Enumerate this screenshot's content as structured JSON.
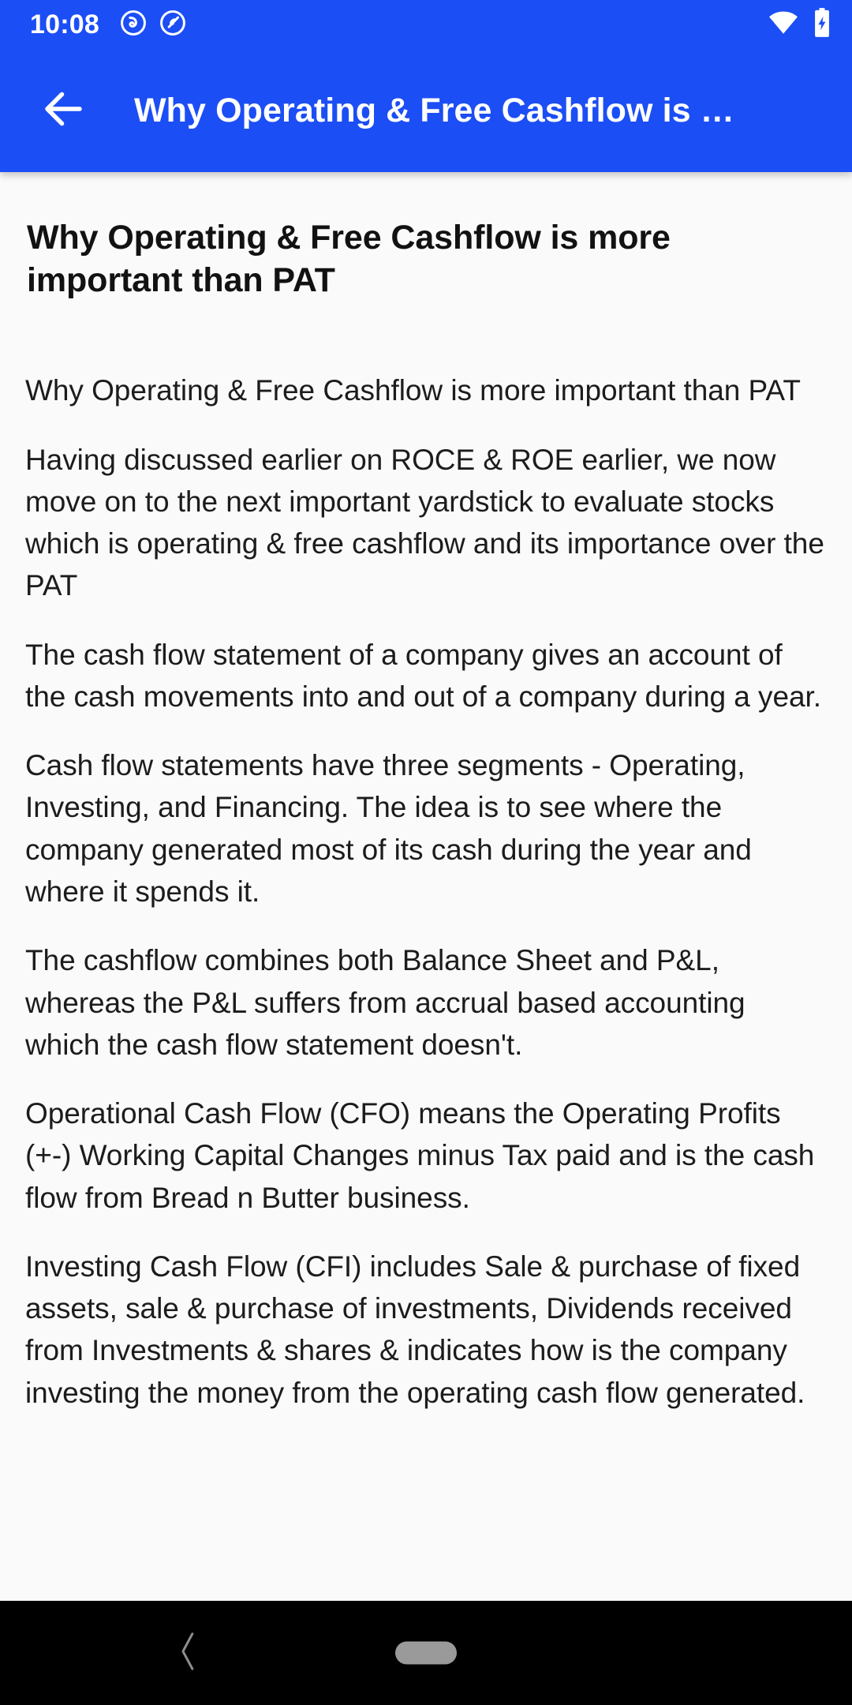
{
  "theme": {
    "accent": "#1c4ef5",
    "content_bg": "#fafafa",
    "text": "#1c1c1c",
    "navbar_bg": "#000000",
    "nav_pill": "#9a9a9a"
  },
  "status_bar": {
    "time": "10:08",
    "left_icons": [
      "do-not-disturb-icon",
      "app-notification-icon"
    ],
    "right_icons": [
      "wifi-icon",
      "battery-charging-icon"
    ]
  },
  "app_bar": {
    "back_icon": "arrow-left-icon",
    "title": "Why Operating & Free Cashflow is …"
  },
  "page": {
    "title": "Why Operating & Free Cashflow is more important than PAT",
    "paragraphs": [
      "Why Operating & Free Cashflow is more important than PAT",
      "Having discussed earlier on ROCE & ROE earlier, we now move on to the next important yardstick to evaluate stocks which is operating & free cashflow and its importance over the PAT",
      "The cash flow statement of a company gives an account of the cash movements into and out of a company during a year.",
      "Cash flow statements have three segments - Operating, Investing, and Financing. The idea is to see where the company generated most of its cash during the year and where it spends it.",
      "The cashflow combines both Balance Sheet and P&L, whereas the P&L suffers from accrual based accounting which the cash flow statement doesn't.",
      "Operational Cash Flow (CFO) means the Operating Profits (+-) Working Capital Changes minus Tax paid and is the cash flow from Bread n Butter business.",
      "Investing Cash Flow (CFI) includes Sale & purchase of fixed assets, sale & purchase of investments, Dividends received from Investments & shares & indicates how is the company investing the money from the operating cash flow generated."
    ]
  },
  "nav_bar": {
    "back_icon": "chevron-left-icon",
    "home_handle": "home-pill-handle"
  }
}
